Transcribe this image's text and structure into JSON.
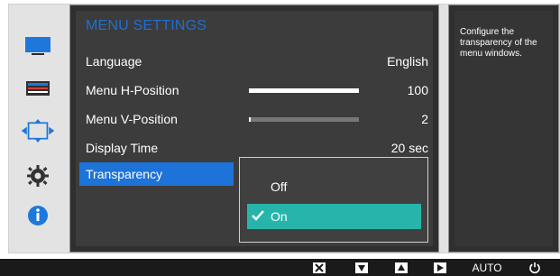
{
  "menu": {
    "title": "MENU SETTINGS",
    "rows": [
      {
        "label": "Language",
        "value": "English"
      },
      {
        "label": "Menu H-Position",
        "value": "100",
        "slider_percent": 100
      },
      {
        "label": "Menu V-Position",
        "value": "2",
        "slider_percent": 2
      },
      {
        "label": "Display Time",
        "value": "20 sec"
      },
      {
        "label": "Transparency",
        "value": ""
      }
    ]
  },
  "popup": {
    "options": [
      {
        "label": "Off",
        "selected": false
      },
      {
        "label": "On",
        "selected": true
      }
    ]
  },
  "help": {
    "text": "Configure the transparency of the menu windows."
  },
  "footer": {
    "auto_label": "AUTO"
  },
  "colors": {
    "accent_blue": "#1d73d8",
    "title_blue": "#1f6fd1",
    "selected_teal": "#27b5ab",
    "panel_dark": "#3c3c3c"
  },
  "left_rail": {
    "icons": [
      "monitor-icon",
      "display-settings-icon",
      "position-arrows-icon",
      "gear-icon",
      "info-icon"
    ]
  },
  "footer_icons": [
    "close-icon",
    "down-icon",
    "up-icon",
    "enter-icon",
    "power-icon"
  ]
}
